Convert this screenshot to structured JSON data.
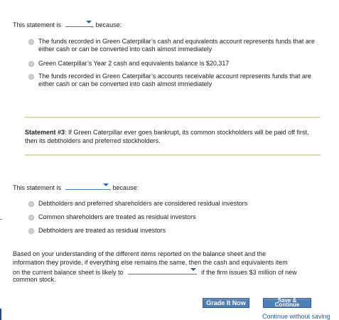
{
  "q1": {
    "prefix": "This statement is",
    "suffix": ", because:",
    "options": [
      "The funds recorded in Green Caterpillar’s cash and equivalents account represents funds that are either cash or can be converted into cash almost immediately",
      "Green Caterpillar’s Year 2 cash and equivalents balance is $20,317",
      "The funds recorded in Green Caterpillar’s accounts receivable account represents funds that are either cash or can be converted into cash almost immediately"
    ]
  },
  "statement3": {
    "label": "Statement #3",
    "text": ": If Green Caterpillar ever goes bankrupt, its common stockholders will be paid off first, then its debtholders and preferred stockholders."
  },
  "q2": {
    "prefix": "This statement is",
    "suffix": ", because:",
    "options": [
      "Debtholders and preferred shareholders are considered residual investors",
      "Common shareholders are treated as residual investors",
      "Debtholders are treated as residual investors"
    ]
  },
  "q3": {
    "line1": "Based on your understanding of the different items reported on the balance sheet and the",
    "line2": "information they provide, if everything else remains the same, then the cash and equivalents item",
    "line3_prefix": "on the current balance sheet is likely to",
    "line3_suffix": "if the firm issues $3 million of new",
    "line4": "common stock."
  },
  "actions": {
    "grade": "Grade It Now",
    "save_line1": "Save &",
    "save_line2": "Continue",
    "continue_without_saving": "Continue without saving"
  },
  "colors": {
    "accent": "#2a66b0",
    "rule": "#e4d9ad",
    "button": "#4f7fb8"
  }
}
